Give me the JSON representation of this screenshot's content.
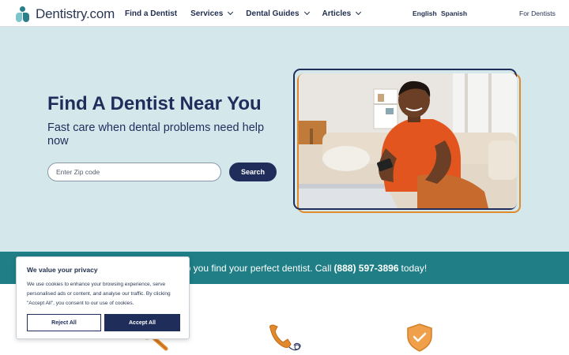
{
  "header": {
    "logo_text": "Dentistry.com",
    "nav": [
      {
        "label": "Find a Dentist"
      },
      {
        "label": "Services"
      },
      {
        "label": "Dental Guides"
      },
      {
        "label": "Articles"
      }
    ],
    "languages": [
      "English",
      "Spanish"
    ],
    "for_dentists": "For Dentists"
  },
  "hero": {
    "title": "Find A Dentist Near You",
    "subtitle": "Fast care when dental problems need help now",
    "zip_placeholder": "Enter Zip code",
    "search_label": "Search"
  },
  "banner": {
    "text_before": "lp you find your perfect dentist. Call",
    "phone": "(888) 597-3896",
    "text_after": "today!"
  },
  "features": {
    "icons": [
      "magnifier-icon",
      "phone-icon",
      "shield-check-icon"
    ]
  },
  "cookie": {
    "title": "We value your privacy",
    "body": "We use cookies to enhance your browsing experience, serve personalised ads or content, and analyse our traffic. By clicking \"Accept All\", you consent to our use of cookies.",
    "reject_label": "Reject All",
    "accept_label": "Accept All"
  },
  "colors": {
    "navy": "#1f2d5a",
    "teal": "#1f7e86",
    "hero_bg": "#d4e8ec",
    "orange": "#e08a2c"
  }
}
